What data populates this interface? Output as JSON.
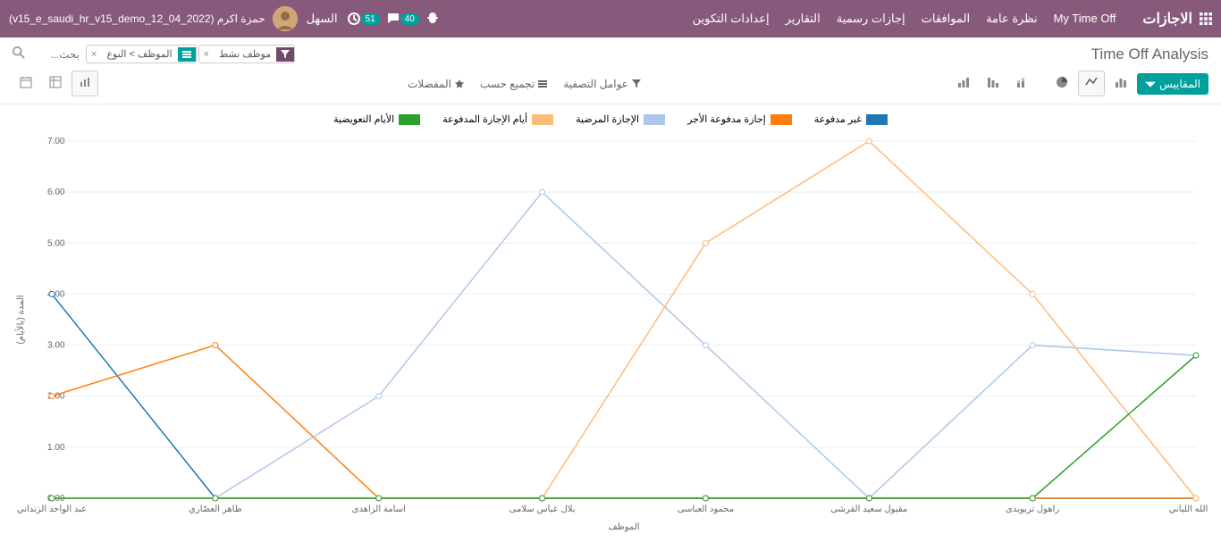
{
  "header": {
    "app_title": "الاجازات",
    "menu": [
      "My Time Off",
      "نظرة عامة",
      "الموافقات",
      "إجازات رسمية",
      "التقارير",
      "إعدادات التكوين"
    ],
    "chat_badge": "40",
    "activity_badge": "51",
    "company": "السهل",
    "user": "حمزة اكرم (v15_e_saudi_hr_v15_demo_12_04_2022)"
  },
  "controls": {
    "title": "Time Off Analysis",
    "facet1": "موظف نشط",
    "facet2": "الموظف > النوع",
    "search_placeholder": "بحث...",
    "measures": "المقاييس",
    "filters": "عوامل التصفية",
    "groupby": "تجميع حسب",
    "favorites": "المفضلات"
  },
  "chart_data": {
    "type": "line",
    "xlabel": "الموظف",
    "ylabel": "المدة (بالأيام)",
    "ylim": [
      0,
      7
    ],
    "y_ticks": [
      "0.00",
      "1.00",
      "2.00",
      "3.00",
      "4.00",
      "5.00",
      "6.00",
      "7.00"
    ],
    "categories": [
      "عبد الواحد الزنداني",
      "طاهر العصّاري",
      "اسامة الزاهدى",
      "بلال عباس سلامى",
      "محمود العباسى",
      "مقبول سعيد القرشى",
      "راهول تريويدى",
      "عبد الله اللباني"
    ],
    "series": [
      {
        "name": "غير مدفوعة",
        "color": "#1f77b4",
        "values": [
          4,
          0,
          0,
          0,
          0,
          0,
          0,
          0
        ]
      },
      {
        "name": "إجازة مدفوعة الأجر",
        "color": "#ff7f0e",
        "values": [
          2,
          3,
          0,
          0,
          0,
          0,
          0,
          0
        ]
      },
      {
        "name": "الإجازة المرضية",
        "color": "#aec7e8",
        "values": [
          0,
          0,
          2,
          6,
          3,
          0,
          3,
          2.8
        ]
      },
      {
        "name": "أيام الإجازة المدفوعة",
        "color": "#ffbb78",
        "values": [
          0,
          0,
          0,
          0,
          5,
          7,
          4,
          0
        ]
      },
      {
        "name": "الأيام التعويضية",
        "color": "#2ca02c",
        "values": [
          0,
          0,
          0,
          0,
          0,
          0,
          0,
          2.8
        ]
      }
    ]
  }
}
